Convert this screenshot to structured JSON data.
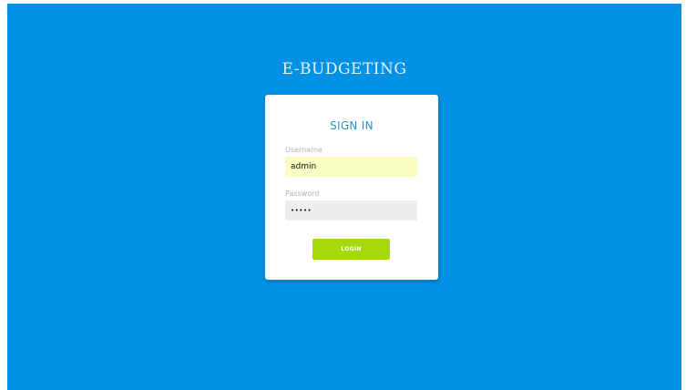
{
  "app": {
    "title": "E-BUDGETING"
  },
  "login": {
    "heading": "SIGN IN",
    "username_label": "Username",
    "username_value": "admin",
    "password_label": "Password",
    "password_value": "•••••",
    "button_label": "LOGIN"
  },
  "colors": {
    "background": "#0391e6",
    "heading": "#2a8fd6",
    "button": "#a5d80a",
    "username_field": "#f9fcc3",
    "password_field": "#eeeeee"
  }
}
